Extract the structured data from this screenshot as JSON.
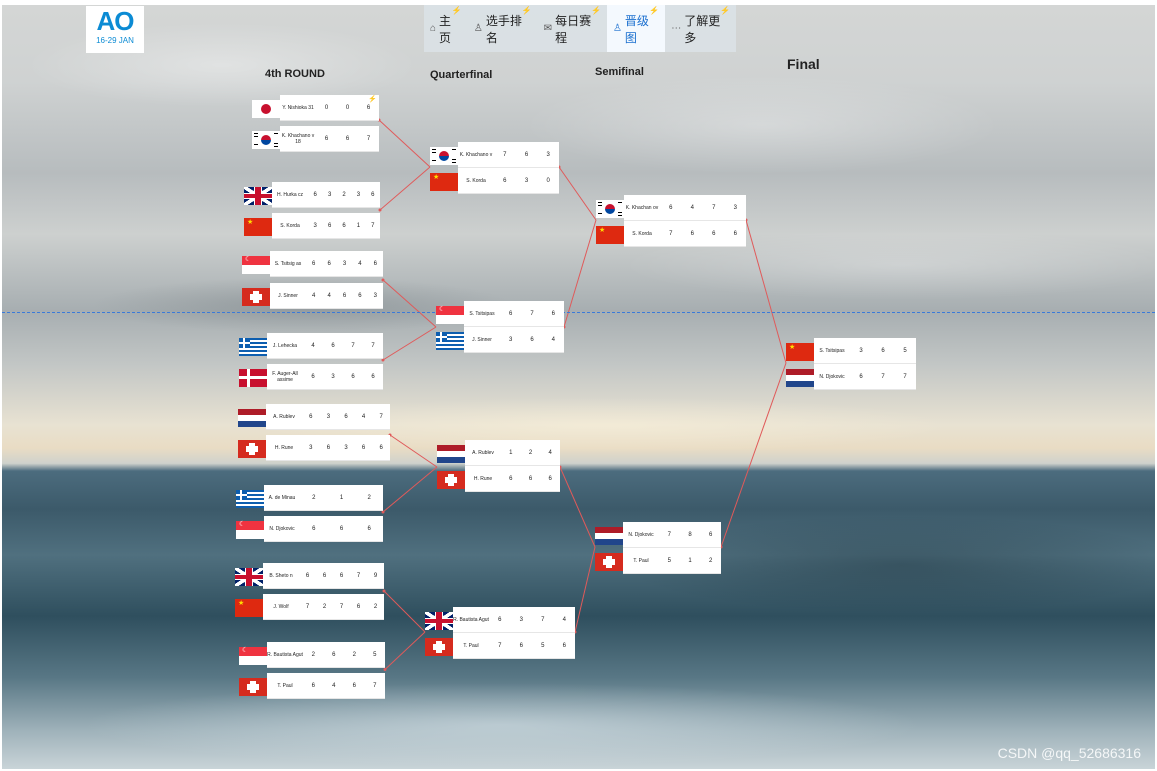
{
  "logo": {
    "mark": "AO",
    "dates": "16-29 JAN"
  },
  "nav": [
    {
      "icon": "home-icon",
      "glyph": "⌂",
      "label": "主页",
      "badge": "⚡"
    },
    {
      "icon": "user-icon",
      "glyph": "♙",
      "label": "选手排名",
      "badge": "⚡"
    },
    {
      "icon": "mail-icon",
      "glyph": "✉",
      "label": "每日赛程",
      "badge": "⚡"
    },
    {
      "icon": "person-icon",
      "glyph": "♙",
      "label": "晋级图",
      "badge": "⚡",
      "active": true
    },
    {
      "icon": "more-icon",
      "glyph": "⋯",
      "label": "了解更多",
      "badge": "⚡"
    }
  ],
  "rounds": [
    "4th    ROUND",
    "Quarterfinal",
    "Semifinal",
    "Final"
  ],
  "matches": [
    {
      "round": 0,
      "warn": "⚡",
      "players": [
        {
          "flag": "jp",
          "name": "Y. Nishioka 31",
          "scores": [
            "0",
            "0",
            "6"
          ]
        },
        {
          "flag": "kr",
          "name": "K. Khachano v 18",
          "scores": [
            "6",
            "6",
            "7"
          ]
        }
      ]
    },
    {
      "round": 0,
      "players": [
        {
          "flag": "gb",
          "name": "H. Hurka cz",
          "scores": [
            "6",
            "3",
            "2",
            "3",
            "6"
          ]
        },
        {
          "flag": "cn",
          "name": "S. Korda",
          "scores": [
            "3",
            "6",
            "6",
            "1",
            "7"
          ]
        }
      ]
    },
    {
      "round": 0,
      "players": [
        {
          "flag": "sg",
          "name": "S. Tsitsig as",
          "scores": [
            "6",
            "6",
            "3",
            "4",
            "6"
          ]
        },
        {
          "flag": "ch",
          "name": "J. Sinner",
          "scores": [
            "4",
            "4",
            "6",
            "6",
            "3"
          ]
        }
      ]
    },
    {
      "round": 0,
      "players": [
        {
          "flag": "gr",
          "name": "J. Lehecka",
          "scores": [
            "4",
            "6",
            "7",
            "7"
          ]
        },
        {
          "flag": "dk",
          "name": "F. Auger-All assime",
          "scores": [
            "6",
            "3",
            "6",
            "6"
          ]
        }
      ]
    },
    {
      "round": 0,
      "players": [
        {
          "flag": "nl",
          "name": "A. Rublev",
          "scores": [
            "6",
            "3",
            "6",
            "4",
            "7"
          ]
        },
        {
          "flag": "ch",
          "name": "H. Rune",
          "scores": [
            "3",
            "6",
            "3",
            "6",
            "6"
          ]
        }
      ]
    },
    {
      "round": 0,
      "players": [
        {
          "flag": "gr",
          "name": "A. de Minau",
          "scores": [
            "2",
            "1",
            "2"
          ]
        },
        {
          "flag": "sg",
          "name": "N. Djokovic",
          "scores": [
            "6",
            "6",
            "6"
          ]
        }
      ]
    },
    {
      "round": 0,
      "players": [
        {
          "flag": "gb",
          "name": "B. Sheto n",
          "scores": [
            "6",
            "6",
            "6",
            "7",
            "9"
          ]
        },
        {
          "flag": "cn",
          "name": "J. Wolf",
          "scores": [
            "7",
            "2",
            "7",
            "6",
            "2"
          ]
        }
      ]
    },
    {
      "round": 0,
      "players": [
        {
          "flag": "sg",
          "name": "R. Bautista Agut",
          "scores": [
            "2",
            "6",
            "2",
            "5"
          ]
        },
        {
          "flag": "ch",
          "name": "T. Paul",
          "scores": [
            "6",
            "4",
            "6",
            "7"
          ]
        }
      ]
    },
    {
      "round": 1,
      "players": [
        {
          "flag": "kr",
          "name": "K. Khachano v",
          "scores": [
            "7",
            "6",
            "3"
          ]
        },
        {
          "flag": "cn",
          "name": "S. Korda",
          "scores": [
            "6",
            "3",
            "0"
          ]
        }
      ]
    },
    {
      "round": 1,
      "players": [
        {
          "flag": "sg",
          "name": "S. Tsitsipas",
          "scores": [
            "6",
            "7",
            "6"
          ]
        },
        {
          "flag": "gr",
          "name": "J. Sinner",
          "scores": [
            "3",
            "6",
            "4"
          ]
        }
      ]
    },
    {
      "round": 1,
      "players": [
        {
          "flag": "nl",
          "name": "A. Rublev",
          "scores": [
            "1",
            "2",
            "4"
          ]
        },
        {
          "flag": "ch",
          "name": "H. Rune",
          "scores": [
            "6",
            "6",
            "6"
          ]
        }
      ]
    },
    {
      "round": 1,
      "players": [
        {
          "flag": "gb",
          "name": "R. Bautista Agut",
          "scores": [
            "6",
            "3",
            "7",
            "4"
          ]
        },
        {
          "flag": "ch",
          "name": "T. Paul",
          "scores": [
            "7",
            "6",
            "5",
            "6"
          ]
        }
      ]
    },
    {
      "round": 2,
      "players": [
        {
          "flag": "kr",
          "name": "K. Khachan ov",
          "scores": [
            "6",
            "4",
            "7",
            "3"
          ]
        },
        {
          "flag": "cn",
          "name": "S. Korda",
          "scores": [
            "7",
            "6",
            "6",
            "6"
          ]
        }
      ]
    },
    {
      "round": 2,
      "players": [
        {
          "flag": "nl",
          "name": "N. Djokovic",
          "scores": [
            "7",
            "8",
            "6"
          ]
        },
        {
          "flag": "ch",
          "name": "T. Paul",
          "scores": [
            "5",
            "1",
            "2"
          ]
        }
      ]
    },
    {
      "round": 3,
      "players": [
        {
          "flag": "cn",
          "name": "S. Tsitsipas",
          "scores": [
            "3",
            "6",
            "5"
          ]
        },
        {
          "flag": "nl",
          "name": "N. Djokovic",
          "scores": [
            "6",
            "7",
            "7"
          ]
        }
      ]
    }
  ],
  "watermark": "CSDN @qq_52686316",
  "colors": {
    "accent": "#1a6fcf",
    "connector": "#e05a5a",
    "guide": "#3a7ad9"
  }
}
